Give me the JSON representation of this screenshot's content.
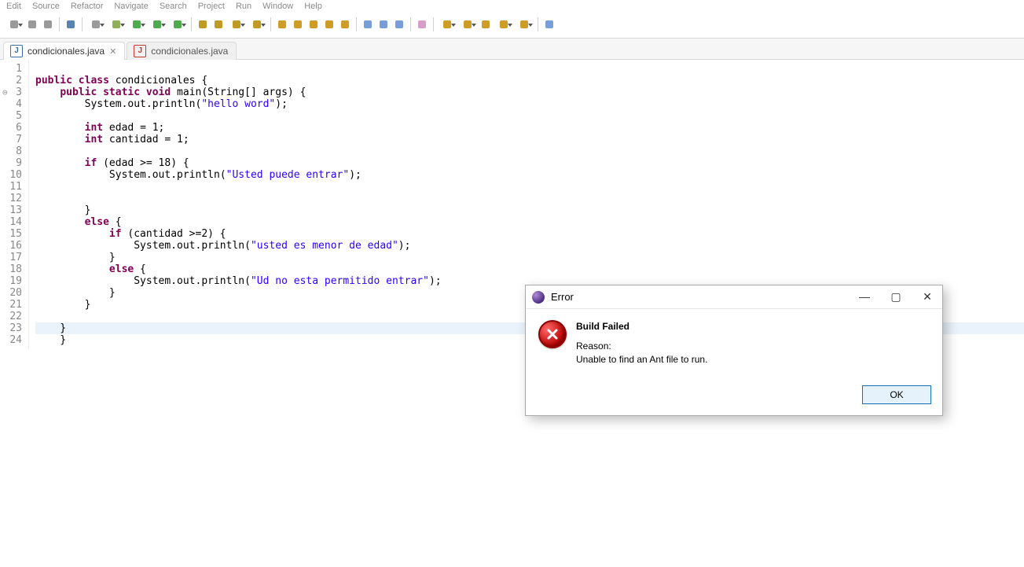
{
  "menubar": [
    "Edit",
    "Source",
    "Refactor",
    "Navigate",
    "Search",
    "Project",
    "Run",
    "Window",
    "Help"
  ],
  "tabs": [
    {
      "label": "condicionales.java",
      "active": true,
      "closeable": true
    },
    {
      "label": "condicionales.java",
      "active": false,
      "closeable": false
    }
  ],
  "code": {
    "highlight_line": 23,
    "lines": [
      {
        "n": 1,
        "ominus": false,
        "tokens": []
      },
      {
        "n": 2,
        "ominus": false,
        "tokens": [
          [
            "kw",
            "public class"
          ],
          [
            "pln",
            " condicionales {"
          ]
        ]
      },
      {
        "n": 3,
        "ominus": true,
        "tokens": [
          [
            "pln",
            "    "
          ],
          [
            "kw",
            "public static void"
          ],
          [
            "pln",
            " main(String[] args) {"
          ]
        ]
      },
      {
        "n": 4,
        "ominus": false,
        "tokens": [
          [
            "pln",
            "        System."
          ],
          [
            "pln",
            "out"
          ],
          [
            "pln",
            ".println("
          ],
          [
            "str",
            "\"hello word\""
          ],
          [
            "pln",
            ");"
          ]
        ]
      },
      {
        "n": 5,
        "ominus": false,
        "tokens": []
      },
      {
        "n": 6,
        "ominus": false,
        "tokens": [
          [
            "pln",
            "        "
          ],
          [
            "kw",
            "int"
          ],
          [
            "pln",
            " edad = 1;"
          ]
        ]
      },
      {
        "n": 7,
        "ominus": false,
        "tokens": [
          [
            "pln",
            "        "
          ],
          [
            "kw",
            "int"
          ],
          [
            "pln",
            " cantidad = 1;"
          ]
        ]
      },
      {
        "n": 8,
        "ominus": false,
        "tokens": []
      },
      {
        "n": 9,
        "ominus": false,
        "tokens": [
          [
            "pln",
            "        "
          ],
          [
            "kw",
            "if"
          ],
          [
            "pln",
            " (edad >= 18) {"
          ]
        ]
      },
      {
        "n": 10,
        "ominus": false,
        "tokens": [
          [
            "pln",
            "            System."
          ],
          [
            "pln",
            "out"
          ],
          [
            "pln",
            ".println("
          ],
          [
            "str",
            "\"Usted puede entrar\""
          ],
          [
            "pln",
            ");"
          ]
        ]
      },
      {
        "n": 11,
        "ominus": false,
        "tokens": []
      },
      {
        "n": 12,
        "ominus": false,
        "tokens": []
      },
      {
        "n": 13,
        "ominus": false,
        "tokens": [
          [
            "pln",
            "        }"
          ]
        ]
      },
      {
        "n": 14,
        "ominus": false,
        "tokens": [
          [
            "pln",
            "        "
          ],
          [
            "kw",
            "else"
          ],
          [
            "pln",
            " {"
          ]
        ]
      },
      {
        "n": 15,
        "ominus": false,
        "tokens": [
          [
            "pln",
            "            "
          ],
          [
            "kw",
            "if"
          ],
          [
            "pln",
            " (cantidad >=2) {"
          ]
        ]
      },
      {
        "n": 16,
        "ominus": false,
        "tokens": [
          [
            "pln",
            "                System."
          ],
          [
            "pln",
            "out"
          ],
          [
            "pln",
            ".println("
          ],
          [
            "str",
            "\"usted es menor de edad\""
          ],
          [
            "pln",
            ");"
          ]
        ]
      },
      {
        "n": 17,
        "ominus": false,
        "tokens": [
          [
            "pln",
            "            }"
          ]
        ]
      },
      {
        "n": 18,
        "ominus": false,
        "tokens": [
          [
            "pln",
            "            "
          ],
          [
            "kw",
            "else"
          ],
          [
            "pln",
            " {"
          ]
        ]
      },
      {
        "n": 19,
        "ominus": false,
        "tokens": [
          [
            "pln",
            "                System."
          ],
          [
            "pln",
            "out"
          ],
          [
            "pln",
            ".println("
          ],
          [
            "str",
            "\"Ud no esta permitido entrar\""
          ],
          [
            "pln",
            ");"
          ]
        ]
      },
      {
        "n": 20,
        "ominus": false,
        "tokens": [
          [
            "pln",
            "            }"
          ]
        ]
      },
      {
        "n": 21,
        "ominus": false,
        "tokens": [
          [
            "pln",
            "        }"
          ]
        ]
      },
      {
        "n": 22,
        "ominus": false,
        "tokens": []
      },
      {
        "n": 23,
        "ominus": false,
        "tokens": [
          [
            "pln",
            "    }"
          ]
        ]
      },
      {
        "n": 24,
        "ominus": false,
        "tokens": [
          [
            "pln",
            "    }"
          ]
        ]
      }
    ]
  },
  "toolbar_icons": [
    {
      "name": "new-icon",
      "color": "#888",
      "drop": true
    },
    {
      "name": "save-icon",
      "color": "#888"
    },
    {
      "name": "save-all-icon",
      "color": "#888"
    },
    {
      "sep": true
    },
    {
      "name": "toggle-breadcrumb-icon",
      "color": "#3b6ea5"
    },
    {
      "sep": true
    },
    {
      "name": "skip-breakpoints-icon",
      "color": "#888",
      "drop": true
    },
    {
      "name": "debug-icon",
      "color": "#7aa23c",
      "drop": true
    },
    {
      "name": "run-icon",
      "color": "#2e9e2e",
      "drop": true
    },
    {
      "name": "coverage-icon",
      "color": "#2e9e2e",
      "drop": true
    },
    {
      "name": "run-last-icon",
      "color": "#2e9e2e",
      "drop": true
    },
    {
      "sep": true
    },
    {
      "name": "new-java-class-icon",
      "color": "#b48a00"
    },
    {
      "name": "new-package-icon",
      "color": "#b48a00"
    },
    {
      "name": "new-java-project-icon",
      "color": "#b48a00",
      "drop": true
    },
    {
      "name": "open-type-icon",
      "color": "#b48a00",
      "drop": true
    },
    {
      "sep": true
    },
    {
      "name": "open-task-icon",
      "color": "#c78b00"
    },
    {
      "name": "open-task-list-icon",
      "color": "#c78b00"
    },
    {
      "name": "search-icon",
      "color": "#c78b00"
    },
    {
      "name": "edit-icon",
      "color": "#c78b00"
    },
    {
      "name": "highlight-icon",
      "color": "#c78b00"
    },
    {
      "sep": true
    },
    {
      "name": "toggle-mark-icon",
      "color": "#5f8dd3"
    },
    {
      "name": "toggle-block-icon",
      "color": "#5f8dd3"
    },
    {
      "name": "show-whitespace-icon",
      "color": "#5f8dd3"
    },
    {
      "sep": true
    },
    {
      "name": "pin-editor-icon",
      "color": "#d08bbf"
    },
    {
      "sep": true
    },
    {
      "name": "next-annotation-icon",
      "color": "#c78b00",
      "drop": true
    },
    {
      "name": "prev-annotation-icon",
      "color": "#c78b00",
      "drop": true
    },
    {
      "name": "last-edit-icon",
      "color": "#c78b00"
    },
    {
      "name": "back-icon",
      "color": "#c78b00",
      "drop": true
    },
    {
      "name": "forward-icon",
      "color": "#c78b00",
      "drop": true
    },
    {
      "sep": true
    },
    {
      "name": "open-perspective-icon",
      "color": "#5f8dd3"
    }
  ],
  "dialog": {
    "title": "Error",
    "header": "Build Failed",
    "reason_label": "Reason:",
    "reason_text": "Unable to find an Ant file to run.",
    "ok_label": "OK"
  }
}
